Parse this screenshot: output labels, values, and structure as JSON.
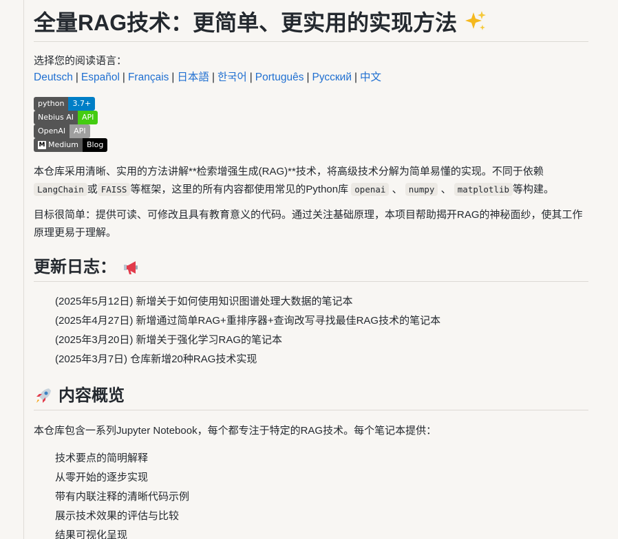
{
  "title": "全量RAG技术：更简单、更实用的实现方法",
  "language_prompt": "选择您的阅读语言：",
  "languages": [
    "Deutsch",
    "Español",
    "Français",
    "日本語",
    "한국어",
    "Português",
    "Русский",
    "中文"
  ],
  "language_separator": "|",
  "badges": [
    {
      "label": "python",
      "value": "3.7+",
      "color": "#007ec6"
    },
    {
      "label": "Nebius AI",
      "value": "API",
      "color": "#4c1"
    },
    {
      "label": "OpenAI",
      "value": "API",
      "color": "#9f9f9f"
    },
    {
      "logo": "M",
      "label": "Medium",
      "value": "Blog",
      "color": "#000000"
    }
  ],
  "intro": {
    "part1": "本仓库采用清晰、实用的方法讲解**检索增强生成(RAG)**技术，将高级技术分解为简单易懂的实现。不同于依赖",
    "code_langchain": "LangChain",
    "or": "或",
    "code_faiss": "FAISS",
    "part2": "等框架，这里的所有内容都使用常见的Python库",
    "code_openai": "openai",
    "sep1": "、",
    "code_numpy": "numpy",
    "sep2": "、",
    "code_matplotlib": "matplotlib",
    "part3": "等构建。"
  },
  "goal": "目标很简单：提供可读、可修改且具有教育意义的代码。通过关注基础原理，本项目帮助揭开RAG的神秘面纱，使其工作原理更易于理解。",
  "changelog": {
    "heading": "更新日志：",
    "items": [
      "(2025年5月12日) 新增关于如何使用知识图谱处理大数据的笔记本",
      "(2025年4月27日) 新增通过简单RAG+重排序器+查询改写寻找最佳RAG技术的笔记本",
      "(2025年3月20日) 新增关于强化学习RAG的笔记本",
      "(2025年3月7日) 仓库新增20种RAG技术实现"
    ]
  },
  "overview": {
    "heading": "内容概览",
    "description": "本仓库包含一系列Jupyter Notebook，每个都专注于特定的RAG技术。每个笔记本提供：",
    "items": [
      "技术要点的简明解释",
      "从零开始的逐步实现",
      "带有内联注释的清晰代码示例",
      "展示技术效果的评估与比较",
      "结果可视化呈现"
    ]
  }
}
